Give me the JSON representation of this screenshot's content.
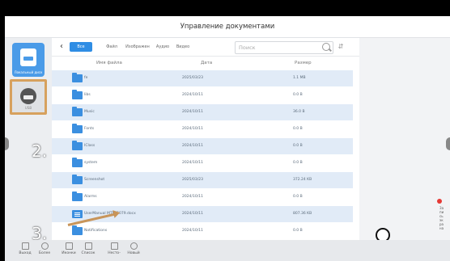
{
  "window": {
    "title": "Управление документами"
  },
  "sidebar": {
    "local_label": "Локальный диск",
    "usb_label": "USB"
  },
  "annotations": {
    "step2": "2.",
    "step3": "3."
  },
  "tabs": [
    "Все",
    "Файл",
    "Изображен",
    "Аудио",
    "Видео"
  ],
  "search": {
    "placeholder": "Поиск"
  },
  "table": {
    "headers": {
      "name": "Имя файла",
      "date": "Дата",
      "size": "Размер"
    },
    "rows": [
      {
        "name": "fe",
        "date": "2025/03/23",
        "size": "1.1 MB",
        "type": "folder"
      },
      {
        "name": "libs",
        "date": "2024/10/11",
        "size": "0.0 B",
        "type": "folder"
      },
      {
        "name": "Music",
        "date": "2024/10/11",
        "size": "36.0 B",
        "type": "folder"
      },
      {
        "name": "Fonts",
        "date": "2024/10/11",
        "size": "0.0 B",
        "type": "folder"
      },
      {
        "name": "IClass",
        "date": "2024/10/11",
        "size": "0.0 B",
        "type": "folder"
      },
      {
        "name": "system",
        "date": "2024/10/11",
        "size": "0.0 B",
        "type": "folder"
      },
      {
        "name": "Screenshot",
        "date": "2025/03/23",
        "size": "372.24 KB",
        "type": "folder"
      },
      {
        "name": "Alarms",
        "date": "2024/10/11",
        "size": "0.0 B",
        "type": "folder"
      },
      {
        "name": "UserManual MTM-5079.docx",
        "date": "2024/10/11",
        "size": "807.36 KB",
        "type": "doc"
      },
      {
        "name": "Notifications",
        "date": "2024/10/11",
        "size": "0.0 B",
        "type": "folder"
      }
    ]
  },
  "bottom": {
    "exit": "Выход",
    "more": "Более",
    "icons": "Иконки",
    "list": "Список",
    "multi": "Несто-",
    "new": "Новый"
  },
  "right_edge_text": "Запись экрана",
  "colors": {
    "accent": "#2f8de4",
    "highlight": "#d7a15d",
    "row_alt": "#e1ebf7"
  }
}
